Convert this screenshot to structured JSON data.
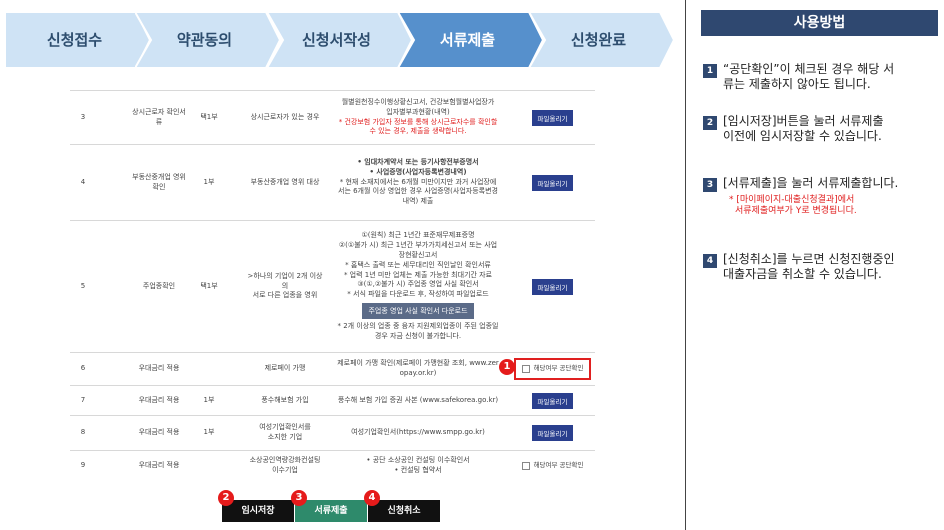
{
  "steps": [
    {
      "label": "신청접수",
      "active": false
    },
    {
      "label": "약관동의",
      "active": false
    },
    {
      "label": "신청서작성",
      "active": false
    },
    {
      "label": "서류제출",
      "active": true
    },
    {
      "label": "신청완료",
      "active": false
    }
  ],
  "colors": {
    "step_inactive": "#cfe3f5",
    "step_active": "#5690cc",
    "accent": "#2f4870",
    "upload_button": "#2a3f8e",
    "highlight": "#e02020",
    "submit_green": "#2e8a6b"
  },
  "rows": [
    {
      "no": "3",
      "item": [
        "상시근로자 확인서",
        "류"
      ],
      "count": "택1부",
      "condition": [
        "상시근로자가 있는 경우"
      ],
      "docs": [
        {
          "t": "월별원천징수이행상황신고서, 건강보험월별사업장가",
          "c": ""
        },
        {
          "t": "입자별부과현황(내역)",
          "c": ""
        },
        {
          "t": "* 건강보험 가입자 정보를 통해 상시근로자수를 확인할",
          "c": "red"
        },
        {
          "t": "수 있는 경우, 제출을 생략합니다.",
          "c": "red"
        }
      ],
      "action": "upload"
    },
    {
      "no": "4",
      "item": [
        "부동산중개업 영위",
        "확인"
      ],
      "count": "1부",
      "condition": [
        "부동산중개업 영위 대상"
      ],
      "docs": [
        {
          "t": "• 임대차계약서 또는 등기사항전부증명서",
          "c": "bold"
        },
        {
          "t": "• 사업증명(사업자등록변경내역)",
          "c": "bold"
        },
        {
          "t": "* 현재 소재지에서는 6개월 미만이지만 과거 사업장에",
          "c": ""
        },
        {
          "t": "서는 6개월 이상 영업한 경우 사업증명(사업자등록변경",
          "c": ""
        },
        {
          "t": "내역) 제출",
          "c": ""
        }
      ],
      "action": "upload"
    },
    {
      "no": "5",
      "item": [
        "주업종확인"
      ],
      "count": "택1부",
      "condition": [
        ">하나의 기업이 2개 이상의",
        "서로 다른 업종을 영위"
      ],
      "docs": [
        {
          "t": "①(원칙) 최근 1년간 표준재무제표증명",
          "c": ""
        },
        {
          "t": "②(①불가 시) 최근 1년간 부가가치세신고서 또는 사업",
          "c": ""
        },
        {
          "t": "장현황신고서",
          "c": ""
        },
        {
          "t": "* 홈택스 출력 또는 세무대리인 직인날인 확인서류",
          "c": ""
        },
        {
          "t": "* 업력 1년 미만 업체는 제출 가능한 최대기간 자료",
          "c": ""
        },
        {
          "t": "③(①,②불가 시) 주업종 영업 사실 확인서",
          "c": ""
        },
        {
          "t": "* 서식 파일을 다운로드 후, 작성하여 파일업로드",
          "c": ""
        },
        {
          "t": "주업종 영업 사실 확인서 다운로드",
          "c": "btn"
        },
        {
          "t": "* 2개 이상의 업종 중 융자 지원제외업종이 주된 업종일",
          "c": ""
        },
        {
          "t": "경우 자금 신청이 불가합니다.",
          "c": ""
        }
      ],
      "action": "upload"
    },
    {
      "no": "6",
      "item": [
        "우대금리 적용"
      ],
      "count": "",
      "condition": [
        "제로페이 가맹"
      ],
      "docs": [
        {
          "t": "제로페이 가맹 확인(제로페이 가맹현황 조회, www.zer",
          "c": ""
        },
        {
          "t": "opay.or.kr)",
          "c": ""
        }
      ],
      "action": "check-hl"
    },
    {
      "no": "7",
      "item": [
        "우대금리 적용"
      ],
      "count": "1부",
      "condition": [
        "풍수해보험 가입"
      ],
      "docs": [
        {
          "t": "풍수해 보험 가입 증권 사본 (www.safekorea.go.kr)",
          "c": ""
        }
      ],
      "action": "upload"
    },
    {
      "no": "8",
      "item": [
        "우대금리 적용"
      ],
      "count": "1부",
      "condition": [
        "여성기업확인서를",
        "소지한 기업"
      ],
      "docs": [
        {
          "t": "여성기업확인서(https://www.smpp.go.kr)",
          "c": ""
        }
      ],
      "action": "upload"
    },
    {
      "no": "9",
      "item": [
        "우대금리 적용"
      ],
      "count": "",
      "condition": [
        "소상공인역량강화컨설팅",
        "이수기업"
      ],
      "docs": [
        {
          "t": "• 공단 소상공인 컨설팅 이수확인서",
          "c": ""
        },
        {
          "t": "• 컨설팅 협약서",
          "c": ""
        }
      ],
      "action": "check"
    }
  ],
  "upload_label": "파일올리기",
  "check_label": "해당여부 공단확인",
  "actions": [
    {
      "label": "임시저장",
      "badge": "2",
      "color": "#111111"
    },
    {
      "label": "서류제출",
      "badge": "3",
      "color": "#2e8a6b"
    },
    {
      "label": "신청취소",
      "badge": "4",
      "color": "#111111"
    }
  ],
  "check_badge": "1",
  "guide": {
    "title": "사용방법",
    "items": [
      {
        "num": "1",
        "lines": [
          "“공단확인”이 체크된 경우 해당 서",
          "류는 제출하지 않아도 됩니다."
        ],
        "note": []
      },
      {
        "num": "2",
        "lines": [
          "[임시저장]버튼을 눌러 서류제출",
          "이전에 임시저장할 수 있습니다."
        ],
        "note": []
      },
      {
        "num": "3",
        "lines": [
          "[서류제출]을 눌러 서류제출합니다."
        ],
        "note": [
          "*  [마이페이지-대출신청결과]에서",
          "서류제출여부가 Y로 변경됩니다."
        ]
      },
      {
        "num": "4",
        "lines": [
          "[신청취소]를 누르면 신청진행중인",
          "대출자금을 취소할 수 있습니다."
        ],
        "note": []
      }
    ]
  }
}
